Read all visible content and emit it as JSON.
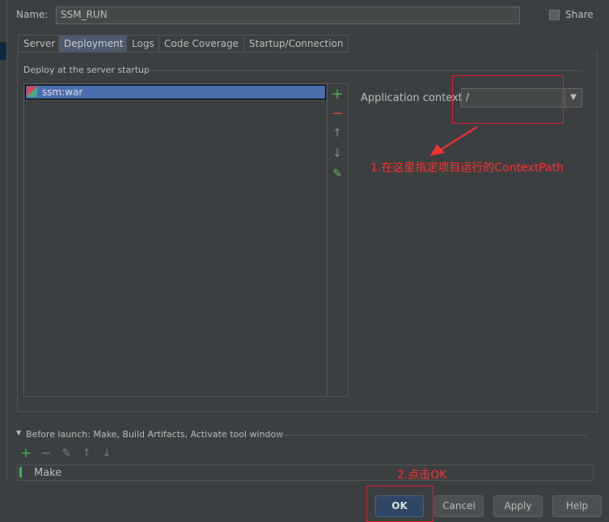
{
  "name": {
    "label": "Name:",
    "value": "SSM_RUN"
  },
  "share": {
    "label": "Share",
    "checked": false
  },
  "tabs": [
    {
      "label": "Server"
    },
    {
      "label": "Deployment",
      "selected": true
    },
    {
      "label": "Logs"
    },
    {
      "label": "Code Coverage"
    },
    {
      "label": "Startup/Connection"
    }
  ],
  "deploy": {
    "title": "Deploy at the server startup",
    "items": [
      "ssm:war"
    ],
    "toolbar": [
      "add-icon",
      "remove-icon",
      "arrow-up-icon",
      "arrow-down-icon",
      "edit-icon"
    ]
  },
  "context": {
    "label": "Application context:",
    "value": "/"
  },
  "annotations": {
    "a1": "1.在这里指定项目运行的ContextPath",
    "a2": "2.点击OK",
    "color": "#ff3030"
  },
  "before_launch": {
    "title": "Before launch: Make, Build Artifacts, Activate tool window",
    "items": [
      "Make"
    ]
  },
  "buttons": {
    "ok": "OK",
    "cancel": "Cancel",
    "apply": "Apply",
    "help": "Help"
  }
}
